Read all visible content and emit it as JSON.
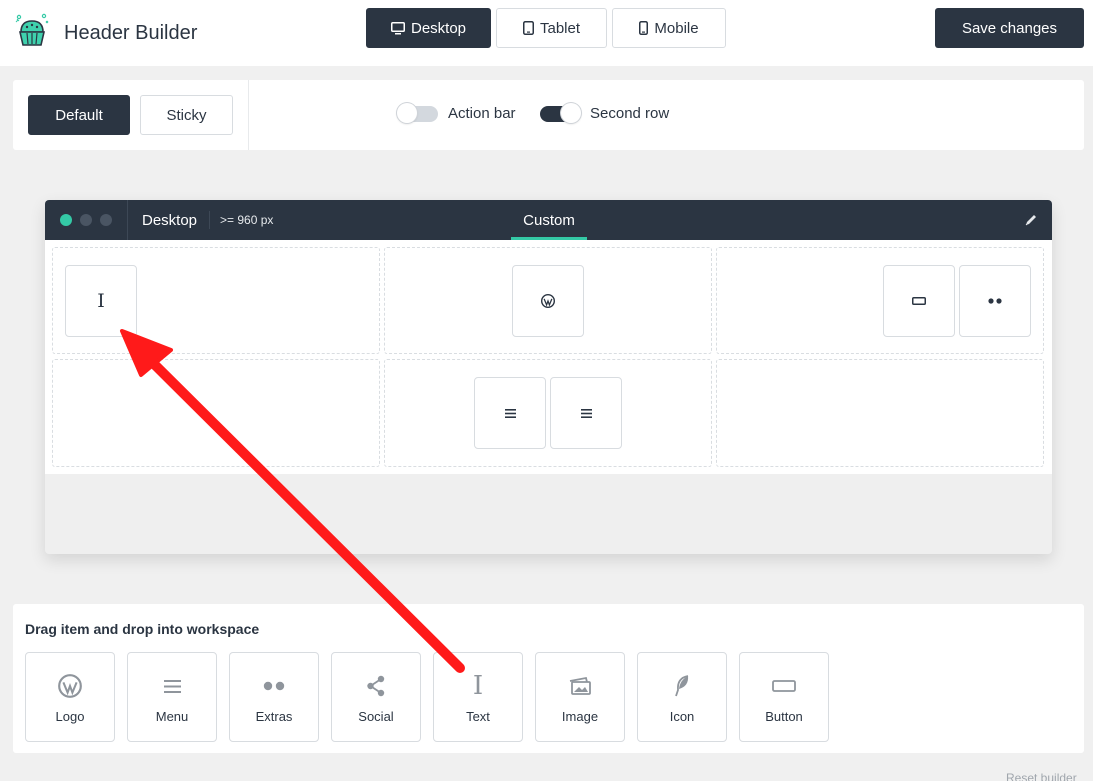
{
  "header": {
    "app_title": "Header Builder",
    "device_tabs": [
      {
        "label": "Desktop",
        "icon": "monitor-icon",
        "active": true
      },
      {
        "label": "Tablet",
        "icon": "tablet-icon",
        "active": false
      },
      {
        "label": "Mobile",
        "icon": "mobile-icon",
        "active": false
      }
    ],
    "save_label": "Save changes"
  },
  "mode": {
    "default_label": "Default",
    "sticky_label": "Sticky",
    "action_bar_label": "Action bar",
    "action_bar_on": false,
    "second_row_label": "Second row",
    "second_row_on": true
  },
  "workspace": {
    "device_label": "Desktop",
    "width_label": ">= 960 px",
    "tab_label": "Custom"
  },
  "items_panel": {
    "title": "Drag item and drop into workspace",
    "items": [
      {
        "label": "Logo",
        "icon": "wordpress-icon"
      },
      {
        "label": "Menu",
        "icon": "menu-icon"
      },
      {
        "label": "Extras",
        "icon": "extras-icon"
      },
      {
        "label": "Social",
        "icon": "share-icon"
      },
      {
        "label": "Text",
        "icon": "text-icon"
      },
      {
        "label": "Image",
        "icon": "image-icon"
      },
      {
        "label": "Icon",
        "icon": "feather-icon"
      },
      {
        "label": "Button",
        "icon": "button-icon"
      }
    ]
  },
  "footer": {
    "reset_label": "Reset builder"
  },
  "colors": {
    "dark": "#2b3542",
    "accent": "#34c9a6",
    "arrow": "#ff1a1a"
  }
}
